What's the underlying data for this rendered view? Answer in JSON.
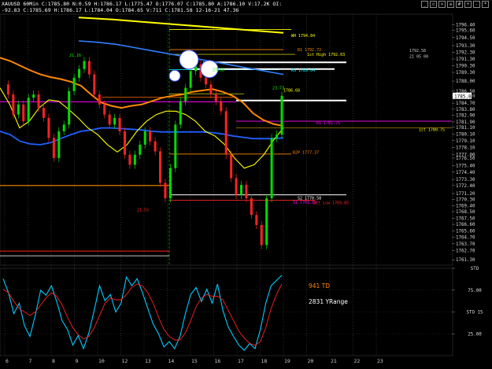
{
  "header": {
    "line1": "XAUUSD 60Min C:1785.80 N:0.59 H:1786.17 L:1775.47 O:1776.07 C:1785.80 A:1786.10 V:17.2K OI:",
    "line2": "-92.83 C:1785.69 H:1786.17 L:1784.04 O:1784.65 V:711 C:1781.58 12-16-21 47.36"
  },
  "toolbar_icons": [
    "minimize-icon",
    "restore-icon",
    "close-icon",
    "menu-icon",
    "grid-icon",
    "plus-icon",
    "minus-icon",
    "settings-icon"
  ],
  "chart_data": [
    {
      "type": "line",
      "title": "",
      "symbol": "XAUUSD",
      "interval": "60Min",
      "x_ticks": [
        "6",
        "7",
        "8",
        "9",
        "10",
        "12",
        "13",
        "14",
        "15",
        "16",
        "17",
        "18",
        "19",
        "20",
        "21",
        "22",
        "23"
      ],
      "y_ticks": [
        1796.4,
        1795.6,
        1794.5,
        1793.3,
        1792.3,
        1791.3,
        1790.3,
        1789.3,
        1788.0,
        1786.5,
        1785.8,
        1784.7,
        1783.8,
        1782.9,
        1781.9,
        1781.1,
        1780.1,
        1779.1,
        1778.1,
        1777.0,
        1776.5,
        1775.4,
        1774.4,
        1773.3,
        1772.4,
        1771.2,
        1770.3,
        1769.4,
        1768.5,
        1767.5,
        1766.6,
        1765.6,
        1764.7,
        1763.7,
        1762.7,
        1761.3
      ],
      "ylim": [
        1760.5,
        1798.0
      ],
      "last_price": 1785.8,
      "annotations": [
        {
          "label": "WH 1794.84",
          "value": 1794.84,
          "color": "#ffff00"
        },
        {
          "label": "R1 1792.72",
          "value": 1792.72,
          "color": "#ff8800"
        },
        {
          "label": "1st High 1792.03",
          "value": 1792.03,
          "color": "#ffff00"
        },
        {
          "label": "1792.58",
          "value": 1792.58,
          "color": "#cccccc"
        },
        {
          "label": "21 05 00",
          "value": 1791.7,
          "color": "#cccccc"
        },
        {
          "label": "RS 1789.64",
          "value": 1789.64,
          "color": "#00ffff"
        },
        {
          "label": "1786.68",
          "value": 1786.68,
          "color": "#ffff00"
        },
        {
          "label": "R1 1781.75",
          "value": 1781.75,
          "color": "#ff00ff"
        },
        {
          "label": "1st 1780.75",
          "value": 1780.75,
          "color": "#ffff00"
        },
        {
          "label": "B2P 1777.37",
          "value": 1777.37,
          "color": "#ff8800"
        },
        {
          "label": "S2 1770.58",
          "value": 1770.58,
          "color": "#ffffff"
        },
        {
          "label": "S1 1769.89",
          "value": 1769.89,
          "color": "#ff00ff"
        },
        {
          "label": "1st Low 1769.85",
          "value": 1769.85,
          "color": "#ff2222"
        },
        {
          "label": "21.16",
          "value": 1791.9,
          "color": "#00ff00"
        },
        {
          "label": "21.55",
          "value": 1768.8,
          "color": "#ff2222"
        },
        {
          "label": "23.73",
          "value": 1787.0,
          "color": "#00ff00"
        },
        {
          "label": "27.68",
          "value": 1789.7,
          "color": "#00ff00"
        }
      ],
      "series": [
        {
          "name": "",
          "color": "#00ff00",
          "values": [
            1787.5,
            1786.0,
            1783.0,
            1784.5,
            1782.0,
            1785.5,
            1786.0,
            1784.0,
            1782.5,
            1779.5,
            1776.5,
            1780.5,
            1781.5,
            1786.5,
            1788.5,
            1789.8,
            1791.0,
            1789.0,
            1786.0,
            1784.5,
            1783.0,
            1781.5,
            1782.5,
            1780.5,
            1777.0,
            1775.5,
            1777.0,
            1778.5,
            1780.5,
            1779.0,
            1777.5,
            1772.8,
            1770.5,
            1775.0,
            1781.5,
            1785.0,
            1787.0,
            1789.5,
            1790.5,
            1788.5,
            1787.5,
            1786.0,
            1785.0,
            1783.5,
            1777.0,
            1773.5,
            1771.0,
            1772.5,
            1770.5,
            1768.0,
            1766.5,
            1763.5,
            1770.5,
            1779.5,
            1780.0,
            1785.8
          ]
        },
        {
          "name": "",
          "color": "#ff8800",
          "values": [
            1791.5,
            1791.0,
            1790.3,
            1789.6,
            1789.0,
            1788.6,
            1788.3,
            1787.9,
            1787.3,
            1786.0,
            1784.8,
            1784.3,
            1784.0,
            1784.3,
            1784.5,
            1785.0,
            1785.5,
            1785.8,
            1786.0,
            1786.4,
            1786.6,
            1786.8,
            1786.4,
            1785.8,
            1784.8,
            1783.2,
            1782.2,
            1781.6,
            1781.3
          ]
        },
        {
          "name": "",
          "color": "#2060ff",
          "values": [
            1780.5,
            1780.0,
            1779.0,
            1778.6,
            1778.5,
            1778.8,
            1779.4,
            1780.0,
            1780.5,
            1780.7,
            1781.0,
            1781.0,
            1780.9,
            1780.8,
            1780.7,
            1780.5,
            1780.4,
            1780.4,
            1780.4,
            1780.4,
            1780.4,
            1780.3,
            1780.1,
            1779.8,
            1779.6,
            1779.4,
            1779.4,
            1779.4,
            1779.5
          ]
        },
        {
          "name": "",
          "color": "#ffff00",
          "values": [
            1787.0,
            1784.5,
            1781.0,
            1782.0,
            1784.0,
            1785.2,
            1785.0,
            1783.8,
            1782.5,
            1781.0,
            1780.0,
            1778.5,
            1777.4,
            1778.5,
            1780.5,
            1782.0,
            1783.0,
            1783.5,
            1783.5,
            1783.0,
            1782.0,
            1780.5,
            1779.8,
            1778.5,
            1776.5,
            1775.0,
            1775.5,
            1777.0,
            1779.2,
            1781.0
          ]
        },
        {
          "name": "",
          "color": "#3080ff",
          "values": [
            1794.0,
            1793.8,
            1793.5,
            1793.0,
            1792.5,
            1792.0,
            1791.5,
            1791.0,
            1790.5,
            1790.0,
            1789.5,
            1789.0
          ]
        },
        {
          "name": "",
          "color": "#ffff00",
          "values": [
            1797.5,
            1797.2,
            1796.8,
            1796.4,
            1796.0,
            1795.6,
            1795.2
          ]
        }
      ]
    },
    {
      "type": "line",
      "title": "",
      "ylim": [
        0,
        100
      ],
      "y_ticks": [
        {
          "label": "STO",
          "value": 100
        },
        {
          "label": "75.00",
          "value": 75
        },
        {
          "label": "STO 15",
          "value": 50
        },
        {
          "label": "25.00",
          "value": 25
        }
      ],
      "annotations": [
        {
          "label": "941 TD",
          "color": "#ff8800"
        },
        {
          "label": "2831 YRange",
          "color": "#ffffff"
        }
      ],
      "series": [
        {
          "name": "",
          "color": "#00ccff",
          "values": [
            88,
            72,
            48,
            60,
            34,
            22,
            46,
            75,
            69,
            80,
            62,
            40,
            30,
            12,
            23,
            8,
            26,
            52,
            80,
            63,
            70,
            50,
            60,
            90,
            80,
            88,
            72,
            54,
            36,
            25,
            10,
            16,
            8,
            22,
            48,
            70,
            78,
            62,
            76,
            60,
            82,
            52,
            33,
            22,
            12,
            6,
            14,
            8,
            30,
            60,
            80,
            86,
            92
          ]
        },
        {
          "name": "",
          "color": "#ff2020",
          "values": [
            76,
            72,
            62,
            54,
            50,
            46,
            50,
            58,
            66,
            72,
            68,
            58,
            44,
            32,
            24,
            19,
            22,
            32,
            46,
            60,
            66,
            64,
            64,
            70,
            78,
            82,
            80,
            72,
            60,
            44,
            30,
            22,
            18,
            18,
            26,
            40,
            56,
            66,
            70,
            68,
            68,
            64,
            52,
            40,
            28,
            20,
            14,
            12,
            16,
            32,
            54,
            70,
            82
          ]
        }
      ]
    }
  ]
}
